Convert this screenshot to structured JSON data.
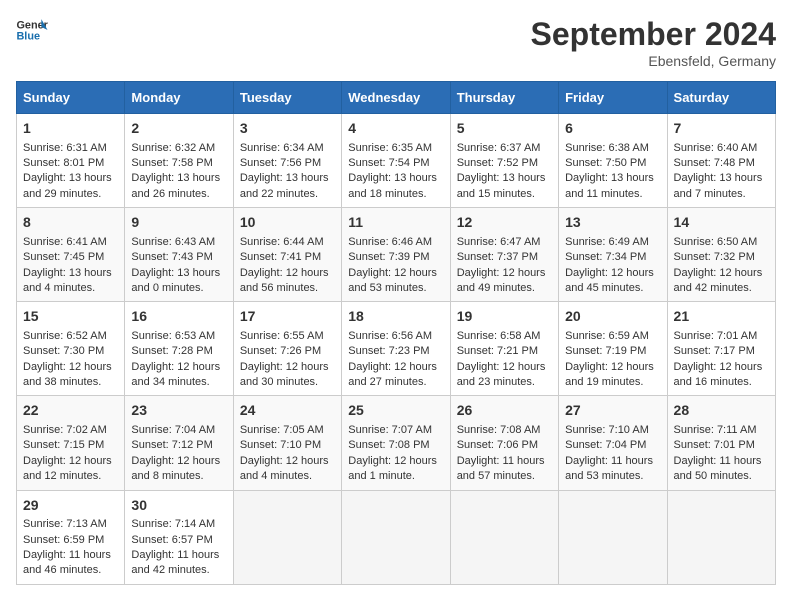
{
  "header": {
    "logo_text_general": "General",
    "logo_text_blue": "Blue",
    "month": "September 2024",
    "location": "Ebensfeld, Germany"
  },
  "days_of_week": [
    "Sunday",
    "Monday",
    "Tuesday",
    "Wednesday",
    "Thursday",
    "Friday",
    "Saturday"
  ],
  "weeks": [
    [
      {
        "day": "1",
        "lines": [
          "Sunrise: 6:31 AM",
          "Sunset: 8:01 PM",
          "Daylight: 13 hours",
          "and 29 minutes."
        ]
      },
      {
        "day": "2",
        "lines": [
          "Sunrise: 6:32 AM",
          "Sunset: 7:58 PM",
          "Daylight: 13 hours",
          "and 26 minutes."
        ]
      },
      {
        "day": "3",
        "lines": [
          "Sunrise: 6:34 AM",
          "Sunset: 7:56 PM",
          "Daylight: 13 hours",
          "and 22 minutes."
        ]
      },
      {
        "day": "4",
        "lines": [
          "Sunrise: 6:35 AM",
          "Sunset: 7:54 PM",
          "Daylight: 13 hours",
          "and 18 minutes."
        ]
      },
      {
        "day": "5",
        "lines": [
          "Sunrise: 6:37 AM",
          "Sunset: 7:52 PM",
          "Daylight: 13 hours",
          "and 15 minutes."
        ]
      },
      {
        "day": "6",
        "lines": [
          "Sunrise: 6:38 AM",
          "Sunset: 7:50 PM",
          "Daylight: 13 hours",
          "and 11 minutes."
        ]
      },
      {
        "day": "7",
        "lines": [
          "Sunrise: 6:40 AM",
          "Sunset: 7:48 PM",
          "Daylight: 13 hours",
          "and 7 minutes."
        ]
      }
    ],
    [
      {
        "day": "8",
        "lines": [
          "Sunrise: 6:41 AM",
          "Sunset: 7:45 PM",
          "Daylight: 13 hours",
          "and 4 minutes."
        ]
      },
      {
        "day": "9",
        "lines": [
          "Sunrise: 6:43 AM",
          "Sunset: 7:43 PM",
          "Daylight: 13 hours",
          "and 0 minutes."
        ]
      },
      {
        "day": "10",
        "lines": [
          "Sunrise: 6:44 AM",
          "Sunset: 7:41 PM",
          "Daylight: 12 hours",
          "and 56 minutes."
        ]
      },
      {
        "day": "11",
        "lines": [
          "Sunrise: 6:46 AM",
          "Sunset: 7:39 PM",
          "Daylight: 12 hours",
          "and 53 minutes."
        ]
      },
      {
        "day": "12",
        "lines": [
          "Sunrise: 6:47 AM",
          "Sunset: 7:37 PM",
          "Daylight: 12 hours",
          "and 49 minutes."
        ]
      },
      {
        "day": "13",
        "lines": [
          "Sunrise: 6:49 AM",
          "Sunset: 7:34 PM",
          "Daylight: 12 hours",
          "and 45 minutes."
        ]
      },
      {
        "day": "14",
        "lines": [
          "Sunrise: 6:50 AM",
          "Sunset: 7:32 PM",
          "Daylight: 12 hours",
          "and 42 minutes."
        ]
      }
    ],
    [
      {
        "day": "15",
        "lines": [
          "Sunrise: 6:52 AM",
          "Sunset: 7:30 PM",
          "Daylight: 12 hours",
          "and 38 minutes."
        ]
      },
      {
        "day": "16",
        "lines": [
          "Sunrise: 6:53 AM",
          "Sunset: 7:28 PM",
          "Daylight: 12 hours",
          "and 34 minutes."
        ]
      },
      {
        "day": "17",
        "lines": [
          "Sunrise: 6:55 AM",
          "Sunset: 7:26 PM",
          "Daylight: 12 hours",
          "and 30 minutes."
        ]
      },
      {
        "day": "18",
        "lines": [
          "Sunrise: 6:56 AM",
          "Sunset: 7:23 PM",
          "Daylight: 12 hours",
          "and 27 minutes."
        ]
      },
      {
        "day": "19",
        "lines": [
          "Sunrise: 6:58 AM",
          "Sunset: 7:21 PM",
          "Daylight: 12 hours",
          "and 23 minutes."
        ]
      },
      {
        "day": "20",
        "lines": [
          "Sunrise: 6:59 AM",
          "Sunset: 7:19 PM",
          "Daylight: 12 hours",
          "and 19 minutes."
        ]
      },
      {
        "day": "21",
        "lines": [
          "Sunrise: 7:01 AM",
          "Sunset: 7:17 PM",
          "Daylight: 12 hours",
          "and 16 minutes."
        ]
      }
    ],
    [
      {
        "day": "22",
        "lines": [
          "Sunrise: 7:02 AM",
          "Sunset: 7:15 PM",
          "Daylight: 12 hours",
          "and 12 minutes."
        ]
      },
      {
        "day": "23",
        "lines": [
          "Sunrise: 7:04 AM",
          "Sunset: 7:12 PM",
          "Daylight: 12 hours",
          "and 8 minutes."
        ]
      },
      {
        "day": "24",
        "lines": [
          "Sunrise: 7:05 AM",
          "Sunset: 7:10 PM",
          "Daylight: 12 hours",
          "and 4 minutes."
        ]
      },
      {
        "day": "25",
        "lines": [
          "Sunrise: 7:07 AM",
          "Sunset: 7:08 PM",
          "Daylight: 12 hours",
          "and 1 minute."
        ]
      },
      {
        "day": "26",
        "lines": [
          "Sunrise: 7:08 AM",
          "Sunset: 7:06 PM",
          "Daylight: 11 hours",
          "and 57 minutes."
        ]
      },
      {
        "day": "27",
        "lines": [
          "Sunrise: 7:10 AM",
          "Sunset: 7:04 PM",
          "Daylight: 11 hours",
          "and 53 minutes."
        ]
      },
      {
        "day": "28",
        "lines": [
          "Sunrise: 7:11 AM",
          "Sunset: 7:01 PM",
          "Daylight: 11 hours",
          "and 50 minutes."
        ]
      }
    ],
    [
      {
        "day": "29",
        "lines": [
          "Sunrise: 7:13 AM",
          "Sunset: 6:59 PM",
          "Daylight: 11 hours",
          "and 46 minutes."
        ]
      },
      {
        "day": "30",
        "lines": [
          "Sunrise: 7:14 AM",
          "Sunset: 6:57 PM",
          "Daylight: 11 hours",
          "and 42 minutes."
        ]
      },
      {
        "day": "",
        "lines": []
      },
      {
        "day": "",
        "lines": []
      },
      {
        "day": "",
        "lines": []
      },
      {
        "day": "",
        "lines": []
      },
      {
        "day": "",
        "lines": []
      }
    ]
  ]
}
